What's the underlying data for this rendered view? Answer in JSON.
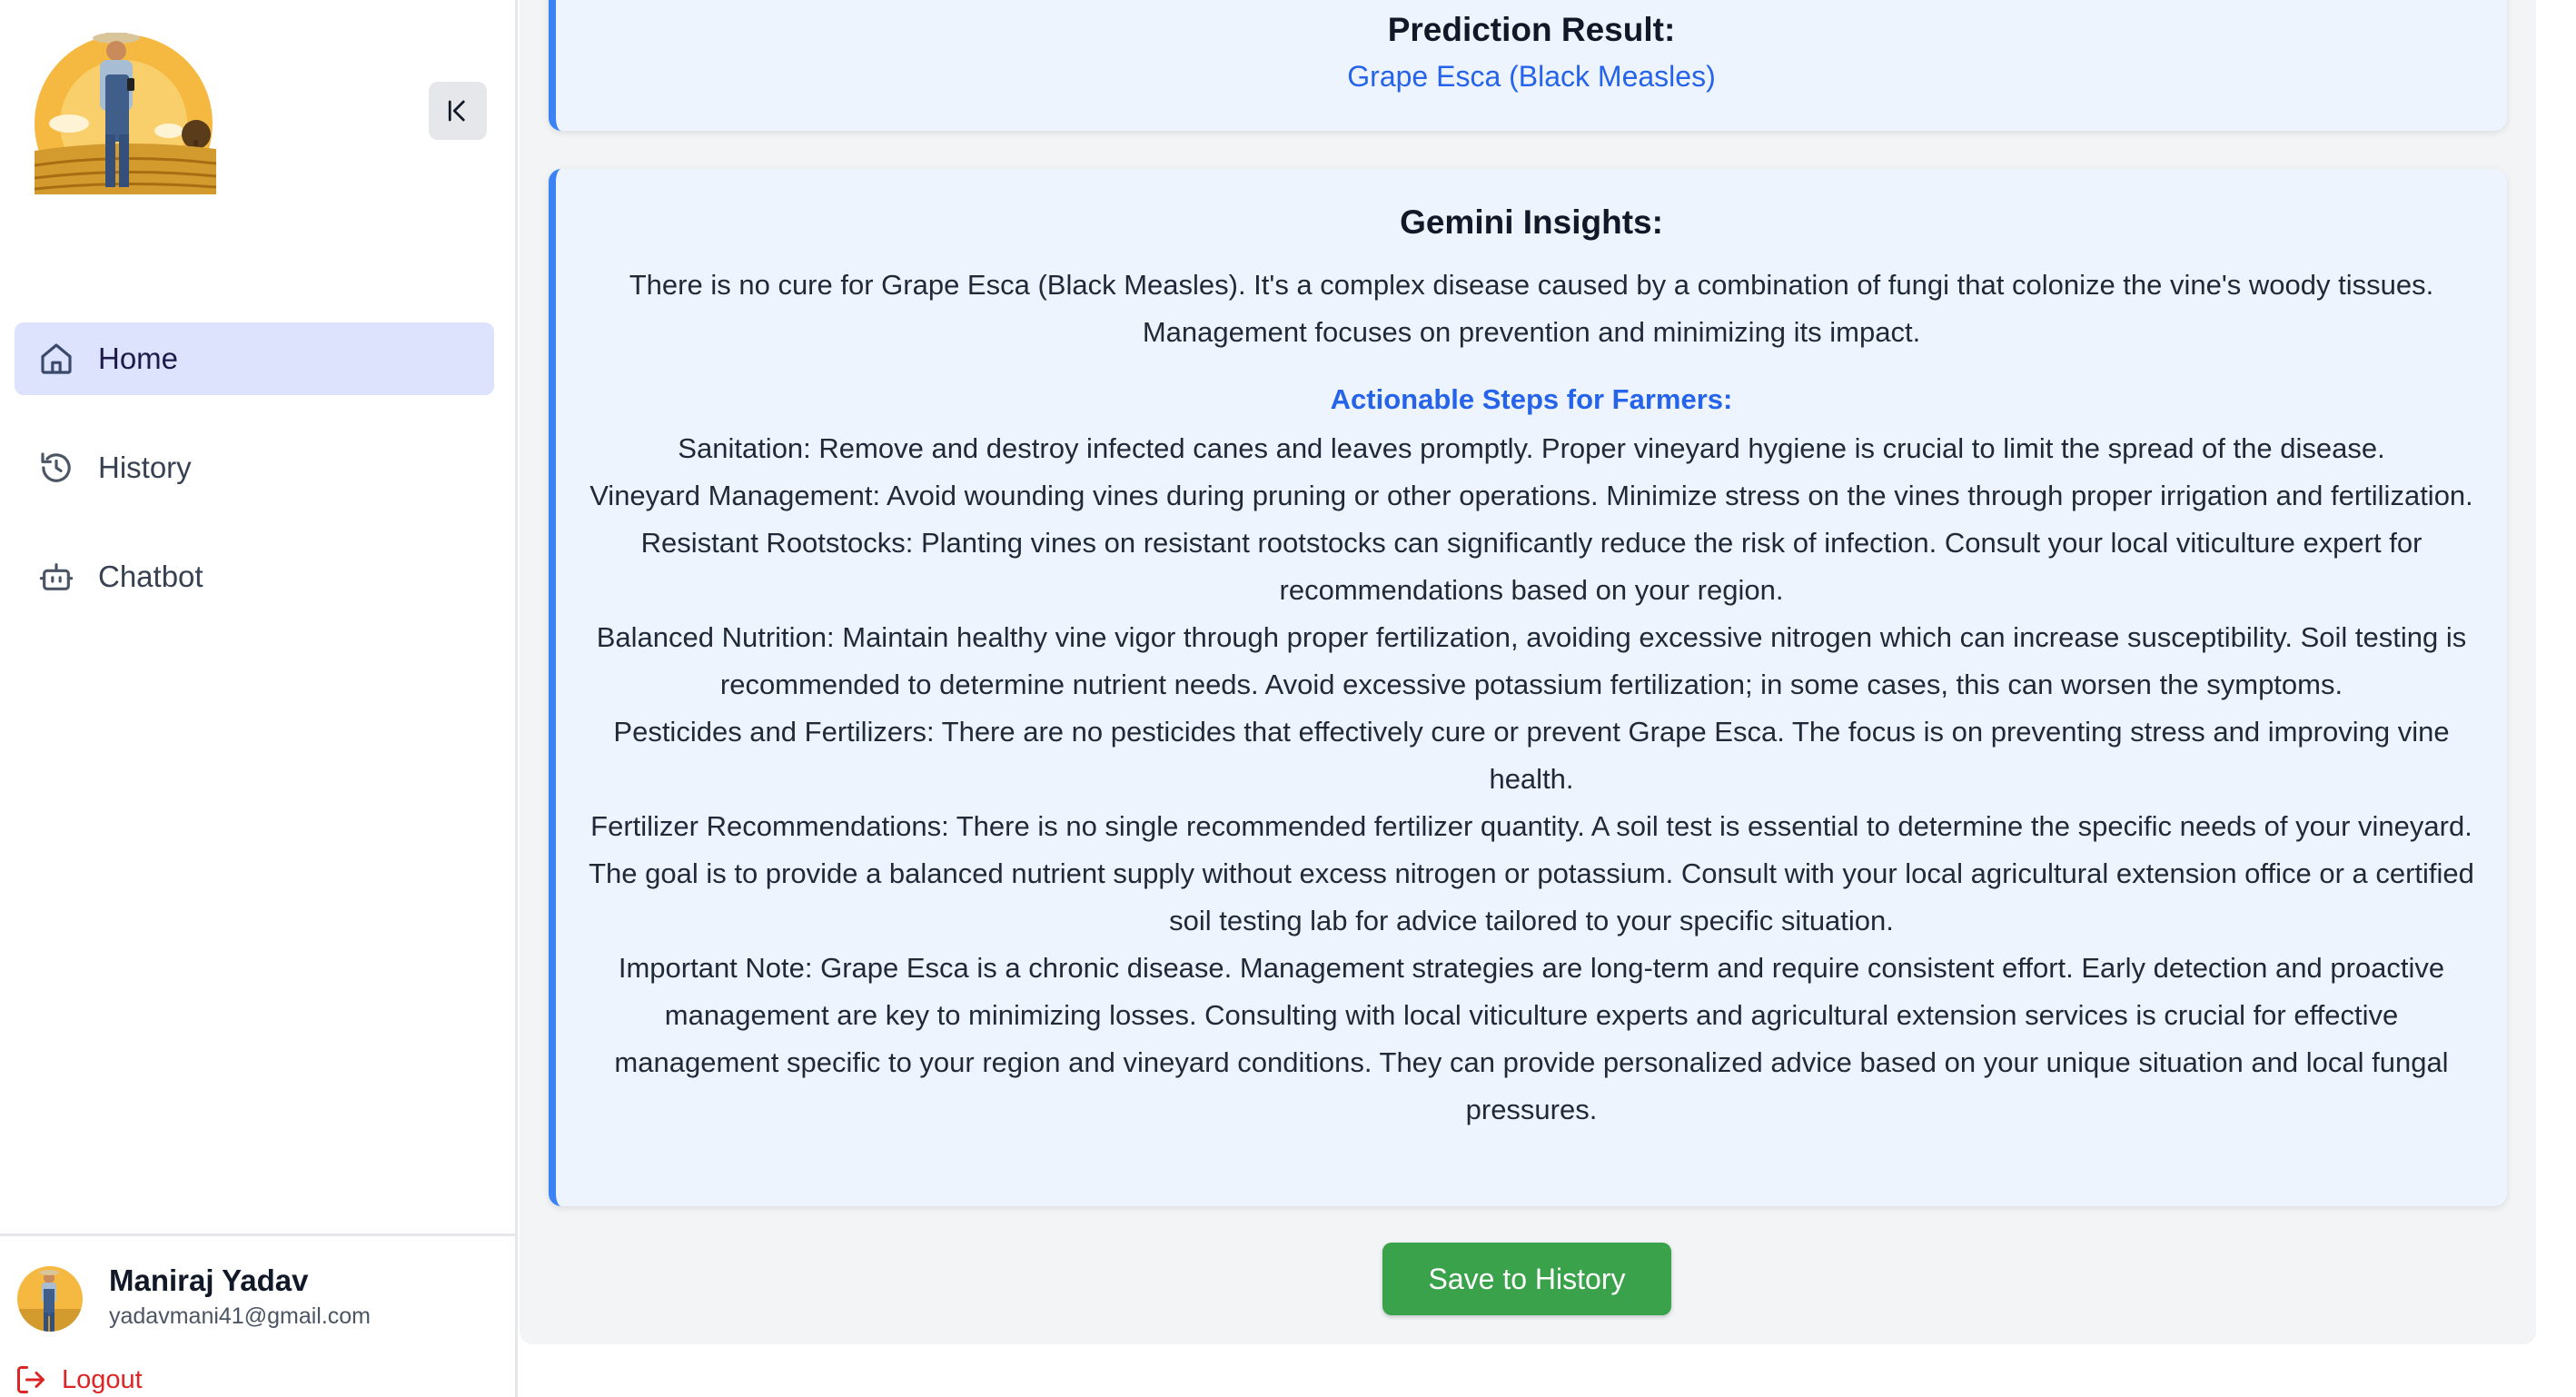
{
  "sidebar": {
    "logo": "farmer-logo",
    "collapse_icon": "collapse-left-icon",
    "nav": [
      {
        "label": "Home",
        "icon": "home-icon",
        "active": true
      },
      {
        "label": "History",
        "icon": "history-icon",
        "active": false
      },
      {
        "label": "Chatbot",
        "icon": "chatbot-icon",
        "active": false
      }
    ],
    "user": {
      "name": "Maniraj Yadav",
      "email": "yadavmani41@gmail.com"
    },
    "logout_label": "Logout"
  },
  "prediction": {
    "title": "Prediction Result:",
    "result": "Grape Esca (Black Measles)"
  },
  "insights": {
    "title": "Gemini Insights:",
    "intro": "There is no cure for Grape Esca (Black Measles). It's a complex disease caused by a combination of fungi that colonize the vine's woody tissues. Management focuses on prevention and minimizing its impact.",
    "steps_heading": "Actionable Steps for Farmers:",
    "steps": [
      "Sanitation: Remove and destroy infected canes and leaves promptly. Proper vineyard hygiene is crucial to limit the spread of the disease.",
      "Vineyard Management: Avoid wounding vines during pruning or other operations. Minimize stress on the vines through proper irrigation and fertilization.",
      "Resistant Rootstocks: Planting vines on resistant rootstocks can significantly reduce the risk of infection. Consult your local viticulture expert for recommendations based on your region.",
      "Balanced Nutrition: Maintain healthy vine vigor through proper fertilization, avoiding excessive nitrogen which can increase susceptibility. Soil testing is recommended to determine nutrient needs. Avoid excessive potassium fertilization; in some cases, this can worsen the symptoms.",
      "Pesticides and Fertilizers: There are no pesticides that effectively cure or prevent Grape Esca. The focus is on preventing stress and improving vine health.",
      "Fertilizer Recommendations: There is no single recommended fertilizer quantity. A soil test is essential to determine the specific needs of your vineyard. The goal is to provide a balanced nutrient supply without excess nitrogen or potassium. Consult with your local agricultural extension office or a certified soil testing lab for advice tailored to your specific situation.",
      "Important Note: Grape Esca is a chronic disease. Management strategies are long-term and require consistent effort. Early detection and proactive management are key to minimizing losses. Consulting with local viticulture experts and agricultural extension services is crucial for effective management specific to your region and vineyard conditions. They can provide personalized advice based on your unique situation and local fungal pressures."
    ]
  },
  "actions": {
    "save_label": "Save to History"
  },
  "colors": {
    "accent": "#3b82f6",
    "link": "#2563eb",
    "nav_active_bg": "#dde3fd",
    "save_button": "#3aa24a",
    "logout": "#dc2626"
  }
}
